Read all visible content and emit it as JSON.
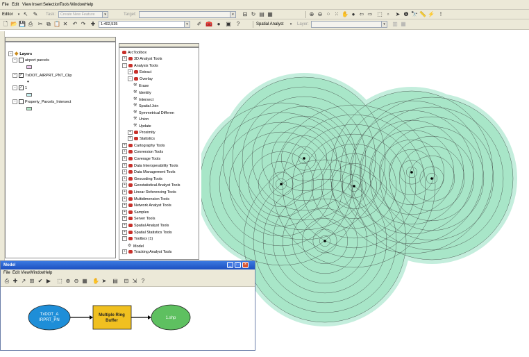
{
  "menus": [
    "File",
    "Edit",
    "View",
    "Insert",
    "Selection",
    "Tools",
    "Window",
    "Help"
  ],
  "toolbar1": {
    "editor_label": "Editor",
    "task_label": "Task:",
    "task_value": "Create New Feature",
    "target_label": "Target:"
  },
  "toolbar2": {
    "scale_value": "1:402,535",
    "spatial_analyst_label": "Spatial Analyst",
    "layer_label": "Layer:"
  },
  "toc": {
    "root": "Layers",
    "layers": [
      {
        "name": "airport parcels",
        "checked": false,
        "swatch_color": "#f0c8f0"
      },
      {
        "name": "TxDOT_AIRPRT_PNT_Clip",
        "checked": true,
        "symbol": "•"
      },
      {
        "name": "1",
        "checked": true,
        "swatch_color": "#c8f0f0"
      },
      {
        "name": "Property_Parcels_Intersect",
        "checked": false,
        "swatch_color": "#b4e8c8"
      }
    ]
  },
  "toolbox": {
    "root": "ArcToolbox",
    "items": [
      {
        "label": "3D Analyst Tools",
        "indent": 1,
        "kind": "box"
      },
      {
        "label": "Analysis Tools",
        "indent": 1,
        "kind": "box",
        "expanded": true
      },
      {
        "label": "Extract",
        "indent": 2,
        "kind": "set"
      },
      {
        "label": "Overlay",
        "indent": 2,
        "kind": "set",
        "expanded": true
      },
      {
        "label": "Erase",
        "indent": 3,
        "kind": "tool"
      },
      {
        "label": "Identity",
        "indent": 3,
        "kind": "tool"
      },
      {
        "label": "Intersect",
        "indent": 3,
        "kind": "tool"
      },
      {
        "label": "Spatial Join",
        "indent": 3,
        "kind": "tool"
      },
      {
        "label": "Symmetrical Differen",
        "indent": 3,
        "kind": "tool"
      },
      {
        "label": "Union",
        "indent": 3,
        "kind": "tool"
      },
      {
        "label": "Update",
        "indent": 3,
        "kind": "tool"
      },
      {
        "label": "Proximity",
        "indent": 2,
        "kind": "set"
      },
      {
        "label": "Statistics",
        "indent": 2,
        "kind": "set"
      },
      {
        "label": "Cartography Tools",
        "indent": 1,
        "kind": "box"
      },
      {
        "label": "Conversion Tools",
        "indent": 1,
        "kind": "box"
      },
      {
        "label": "Coverage Tools",
        "indent": 1,
        "kind": "box"
      },
      {
        "label": "Data Interoperability Tools",
        "indent": 1,
        "kind": "box"
      },
      {
        "label": "Data Management Tools",
        "indent": 1,
        "kind": "box"
      },
      {
        "label": "Geocoding Tools",
        "indent": 1,
        "kind": "box"
      },
      {
        "label": "Geostatistical Analyst Tools",
        "indent": 1,
        "kind": "box"
      },
      {
        "label": "Linear Referencing Tools",
        "indent": 1,
        "kind": "box"
      },
      {
        "label": "Multidimension Tools",
        "indent": 1,
        "kind": "box"
      },
      {
        "label": "Network Analyst Tools",
        "indent": 1,
        "kind": "box"
      },
      {
        "label": "Samples",
        "indent": 1,
        "kind": "box"
      },
      {
        "label": "Server Tools",
        "indent": 1,
        "kind": "box"
      },
      {
        "label": "Spatial Analyst Tools",
        "indent": 1,
        "kind": "box"
      },
      {
        "label": "Spatial Statistics Tools",
        "indent": 1,
        "kind": "box"
      },
      {
        "label": "Toolbox (1)",
        "indent": 1,
        "kind": "box",
        "expanded": true
      },
      {
        "label": "Model",
        "indent": 2,
        "kind": "model"
      },
      {
        "label": "Tracking Analyst Tools",
        "indent": 1,
        "kind": "box"
      }
    ]
  },
  "modelbuilder": {
    "title": "Model",
    "menus": [
      "File",
      "Edit",
      "View",
      "Window",
      "Help"
    ],
    "input_label_line1": "TxDOT_A",
    "input_label_line2": "IRPRT_PN",
    "tool_label_line1": "Multiple Ring",
    "tool_label_line2": "Buffer",
    "output_label": "1.shp",
    "input_color": "#1e8ed8",
    "tool_color": "#f0c020",
    "output_color": "#5ec060"
  },
  "map": {
    "buffer_fill": "#a8e6c8",
    "buffer_outer_fill": "#c4eedd",
    "ring_stroke": "#333333"
  }
}
